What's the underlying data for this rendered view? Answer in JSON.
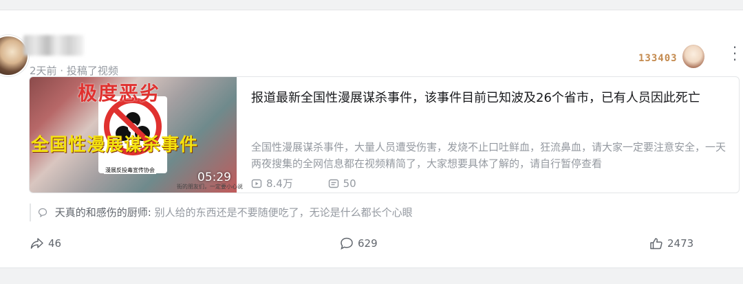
{
  "post": {
    "meta": "2天前 · 投稿了视频",
    "badge_number": "133403"
  },
  "video": {
    "thumbnail_text_top": "极度恶劣",
    "thumbnail_text_main": "全国性漫展谋杀事件",
    "thumbnail_org": "漫展反投毒宣传协会",
    "thumbnail_caption": "街的朋友们，一定要小心说",
    "duration": "05:29",
    "title": "报道最新全国性漫展谋杀事件，该事件目前已知波及26个省市，已有人员因此死亡",
    "description": "全国性漫展谋杀事件，大量人员遭受伤害，发烧不止口吐鲜血，狂流鼻血，请大家一定要注意安全，一天两夜搜集的全网信息都在视频精简了，大家想要具体了解的，请自行暂停查看",
    "views": "8.4万",
    "danmaku": "50"
  },
  "comment": {
    "author": "天真的和感伤的厨师",
    "separator": ": ",
    "text": "别人给的东西还是不要随便吃了，无论是什么都长个心眼"
  },
  "actions": {
    "share": "46",
    "comments": "629",
    "likes": "2473"
  },
  "icons": [
    "more-icon",
    "play-icon",
    "danmaku-icon",
    "comment-bubble-icon",
    "share-icon",
    "reply-icon",
    "like-icon"
  ],
  "colors": {
    "background": "#f1f2f3",
    "card": "#ffffff",
    "text_primary": "#18191c",
    "text_secondary": "#9499a0",
    "badge": "#c48a4e"
  }
}
